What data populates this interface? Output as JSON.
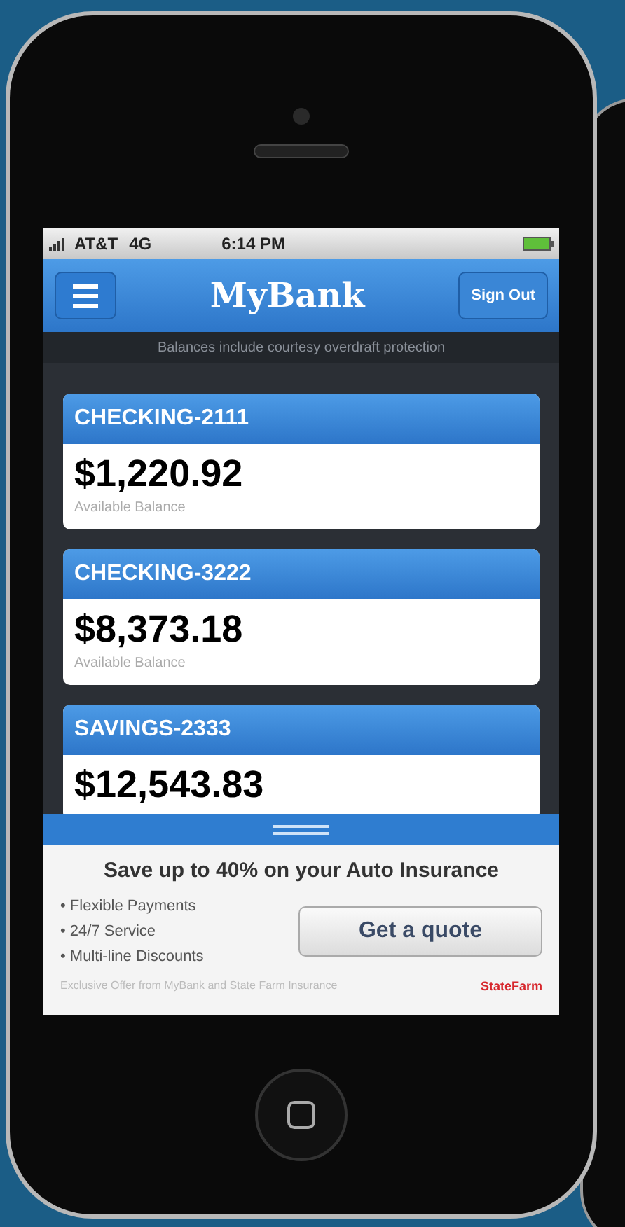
{
  "status_bar": {
    "carrier": "AT&T",
    "network": "4G",
    "time": "6:14 PM"
  },
  "header": {
    "title": "MyBank",
    "sign_out": "Sign Out"
  },
  "notice": "Balances include courtesy overdraft protection",
  "accounts": [
    {
      "name": "CHECKING-2111",
      "balance": "$1,220.92",
      "label": "Available Balance"
    },
    {
      "name": "CHECKING-3222",
      "balance": "$8,373.18",
      "label": "Available Balance"
    },
    {
      "name": "SAVINGS-2333",
      "balance": "$12,543.83"
    }
  ],
  "ad": {
    "headline": "Save up to 40% on your Auto Insurance",
    "bullets": [
      "• Flexible Payments",
      "• 24/7 Service",
      "• Multi-line Discounts"
    ],
    "button": "Get a quote",
    "footer": "Exclusive Offer from MyBank and State Farm Insurance",
    "brand": "StateFarm"
  }
}
